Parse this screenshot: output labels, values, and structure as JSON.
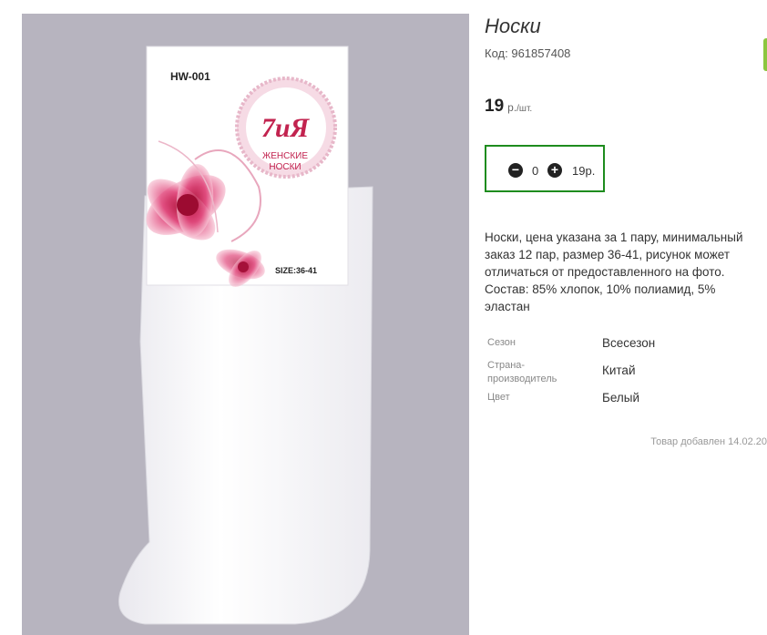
{
  "product": {
    "title": "Носки",
    "code_label": "Код:",
    "code_value": "961857408",
    "price_value": "19",
    "price_currency": "р.",
    "price_unit": "/шт.",
    "quantity": "0",
    "quantity_sum": "19р.",
    "description": "Носки, цена указана за 1 пару, минимальный заказ 12 пар, размер 36-41, рисунок может отличаться от предоставленного на фото. Состав: 85% хлопок, 10% полиамид, 5% эластан",
    "properties": [
      {
        "label": "Сезон",
        "value": "Всесезон"
      },
      {
        "label": "Страна-производитель",
        "value": "Китай"
      },
      {
        "label": "Цвет",
        "value": "Белый"
      }
    ],
    "added_date": "Товар добавлен 14.02.20"
  },
  "package": {
    "model": "HW-001",
    "brand": "7иЯ",
    "line1": "ЖЕНСКИЕ",
    "line2": "НОСКИ",
    "size": "SIZE:36-41"
  },
  "icons": {
    "minus": "minus-circle-icon",
    "plus": "plus-circle-icon"
  },
  "colors": {
    "accent_border": "#1e8c1e",
    "photo_bg": "#b7b4bf",
    "edge_tab": "#8cc63f"
  }
}
